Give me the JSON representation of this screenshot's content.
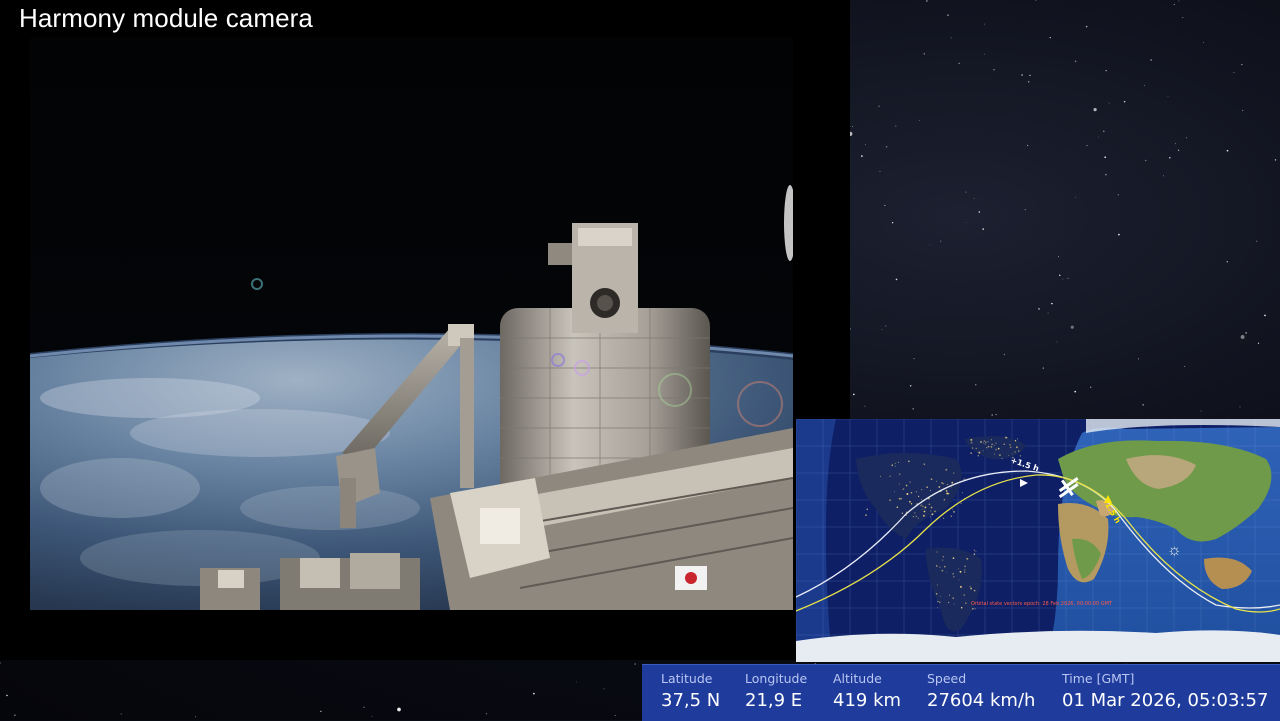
{
  "feed": {
    "title": "Harmony module camera"
  },
  "tracker": {
    "epoch_note": "Orbital state vectors epoch: 28 Feb 2026, 00:00:00 GMT",
    "orbit_plus_label": "+1.5 h",
    "orbit_minus_label": "-1.5 h",
    "sun_icon": "sun-icon",
    "colors": {
      "night": "#0e1f66",
      "ground_track_past": "#e9ecf5",
      "ground_track_future": "#e6e24a",
      "iss_marker": "#ffffff"
    }
  },
  "telemetry": {
    "latitude_label": "Latitude",
    "latitude_value": "37,5 N",
    "longitude_label": "Longitude",
    "longitude_value": "21,9 E",
    "altitude_label": "Altitude",
    "altitude_value": "419 km",
    "speed_label": "Speed",
    "speed_value": "27604 km/h",
    "time_label": "Time [GMT]",
    "time_value": "01 Mar 2026, 05:03:57"
  }
}
